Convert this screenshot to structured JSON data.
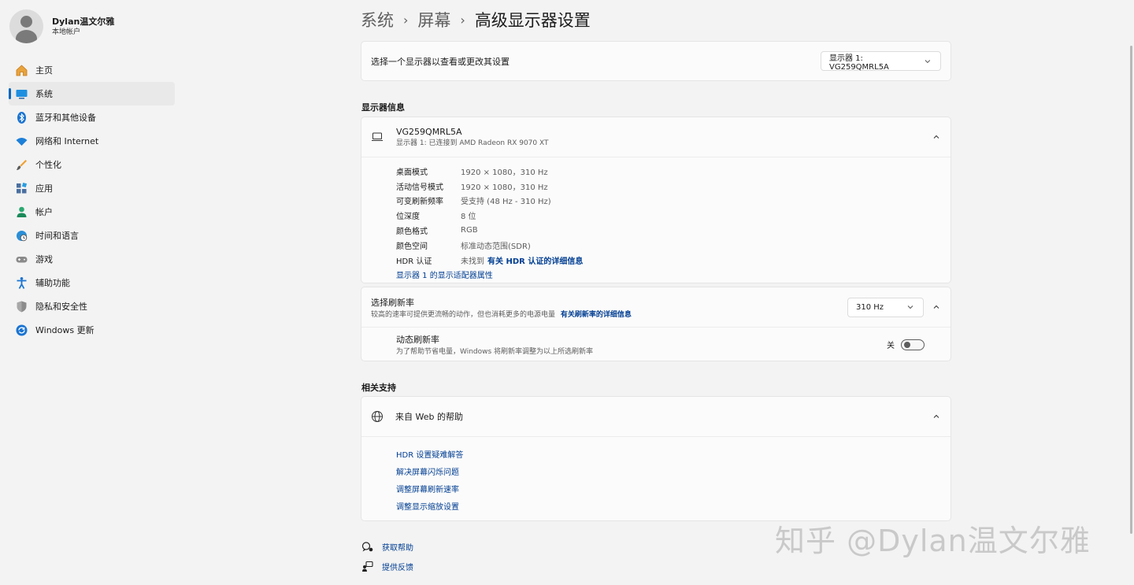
{
  "profile": {
    "name": "Dylan温文尔雅",
    "subtitle": "本地帐户"
  },
  "nav": [
    {
      "label": "主页",
      "icon": "home-icon"
    },
    {
      "label": "系统",
      "icon": "monitor-icon",
      "active": true
    },
    {
      "label": "蓝牙和其他设备",
      "icon": "bluetooth-icon"
    },
    {
      "label": "网络和 Internet",
      "icon": "wifi-icon"
    },
    {
      "label": "个性化",
      "icon": "brush-icon"
    },
    {
      "label": "应用",
      "icon": "apps-icon"
    },
    {
      "label": "帐户",
      "icon": "person-icon"
    },
    {
      "label": "时间和语言",
      "icon": "globe-clock-icon"
    },
    {
      "label": "游戏",
      "icon": "gamepad-icon"
    },
    {
      "label": "辅助功能",
      "icon": "accessibility-icon"
    },
    {
      "label": "隐私和安全性",
      "icon": "shield-icon"
    },
    {
      "label": "Windows 更新",
      "icon": "update-icon"
    }
  ],
  "breadcrumb": {
    "item1": "系统",
    "item2": "屏幕",
    "current": "高级显示器设置"
  },
  "select_display": {
    "label": "选择一个显示器以查看或更改其设置",
    "value": "显示器 1: VG259QMRL5A"
  },
  "display_info": {
    "section_title": "显示器信息",
    "name": "VG259QMRL5A",
    "subtitle": "显示器 1: 已连接到 AMD Radeon RX 9070 XT",
    "rows": [
      {
        "key": "桌面模式",
        "value": "1920 × 1080，310 Hz"
      },
      {
        "key": "活动信号模式",
        "value": "1920 × 1080，310 Hz"
      },
      {
        "key": "可变刷新频率",
        "value": "受支持 (48 Hz - 310 Hz)"
      },
      {
        "key": "位深度",
        "value": "8 位"
      },
      {
        "key": "颜色格式",
        "value": "RGB"
      },
      {
        "key": "颜色空间",
        "value": "标准动态范围(SDR)"
      }
    ],
    "hdr_key": "HDR 认证",
    "hdr_value": "未找到",
    "hdr_link": "有关 HDR 认证的详细信息",
    "adapter_link": "显示器 1 的显示适配器属性"
  },
  "refresh": {
    "label": "选择刷新率",
    "sub": "较高的速率可提供更流畅的动作，但也消耗更多的电源电量",
    "link": "有关刷新率的详细信息",
    "value": "310 Hz",
    "dynamic_label": "动态刷新率",
    "dynamic_sub": "为了帮助节省电量，Windows 将刷新率调整为以上所选刷新率",
    "toggle_state": "关"
  },
  "support": {
    "section_title": "相关支持",
    "header": "来自 Web 的帮助",
    "links": [
      "HDR 设置疑难解答",
      "解决屏幕闪烁问题",
      "调整屏幕刷新速率",
      "调整显示缩放设置"
    ]
  },
  "footer": {
    "get_help": "获取帮助",
    "feedback": "提供反馈"
  },
  "watermark": "知乎 @Dylan温文尔雅",
  "colors": {
    "accent": "#0067c0",
    "link": "#003e92",
    "background": "#f3f3f3"
  }
}
